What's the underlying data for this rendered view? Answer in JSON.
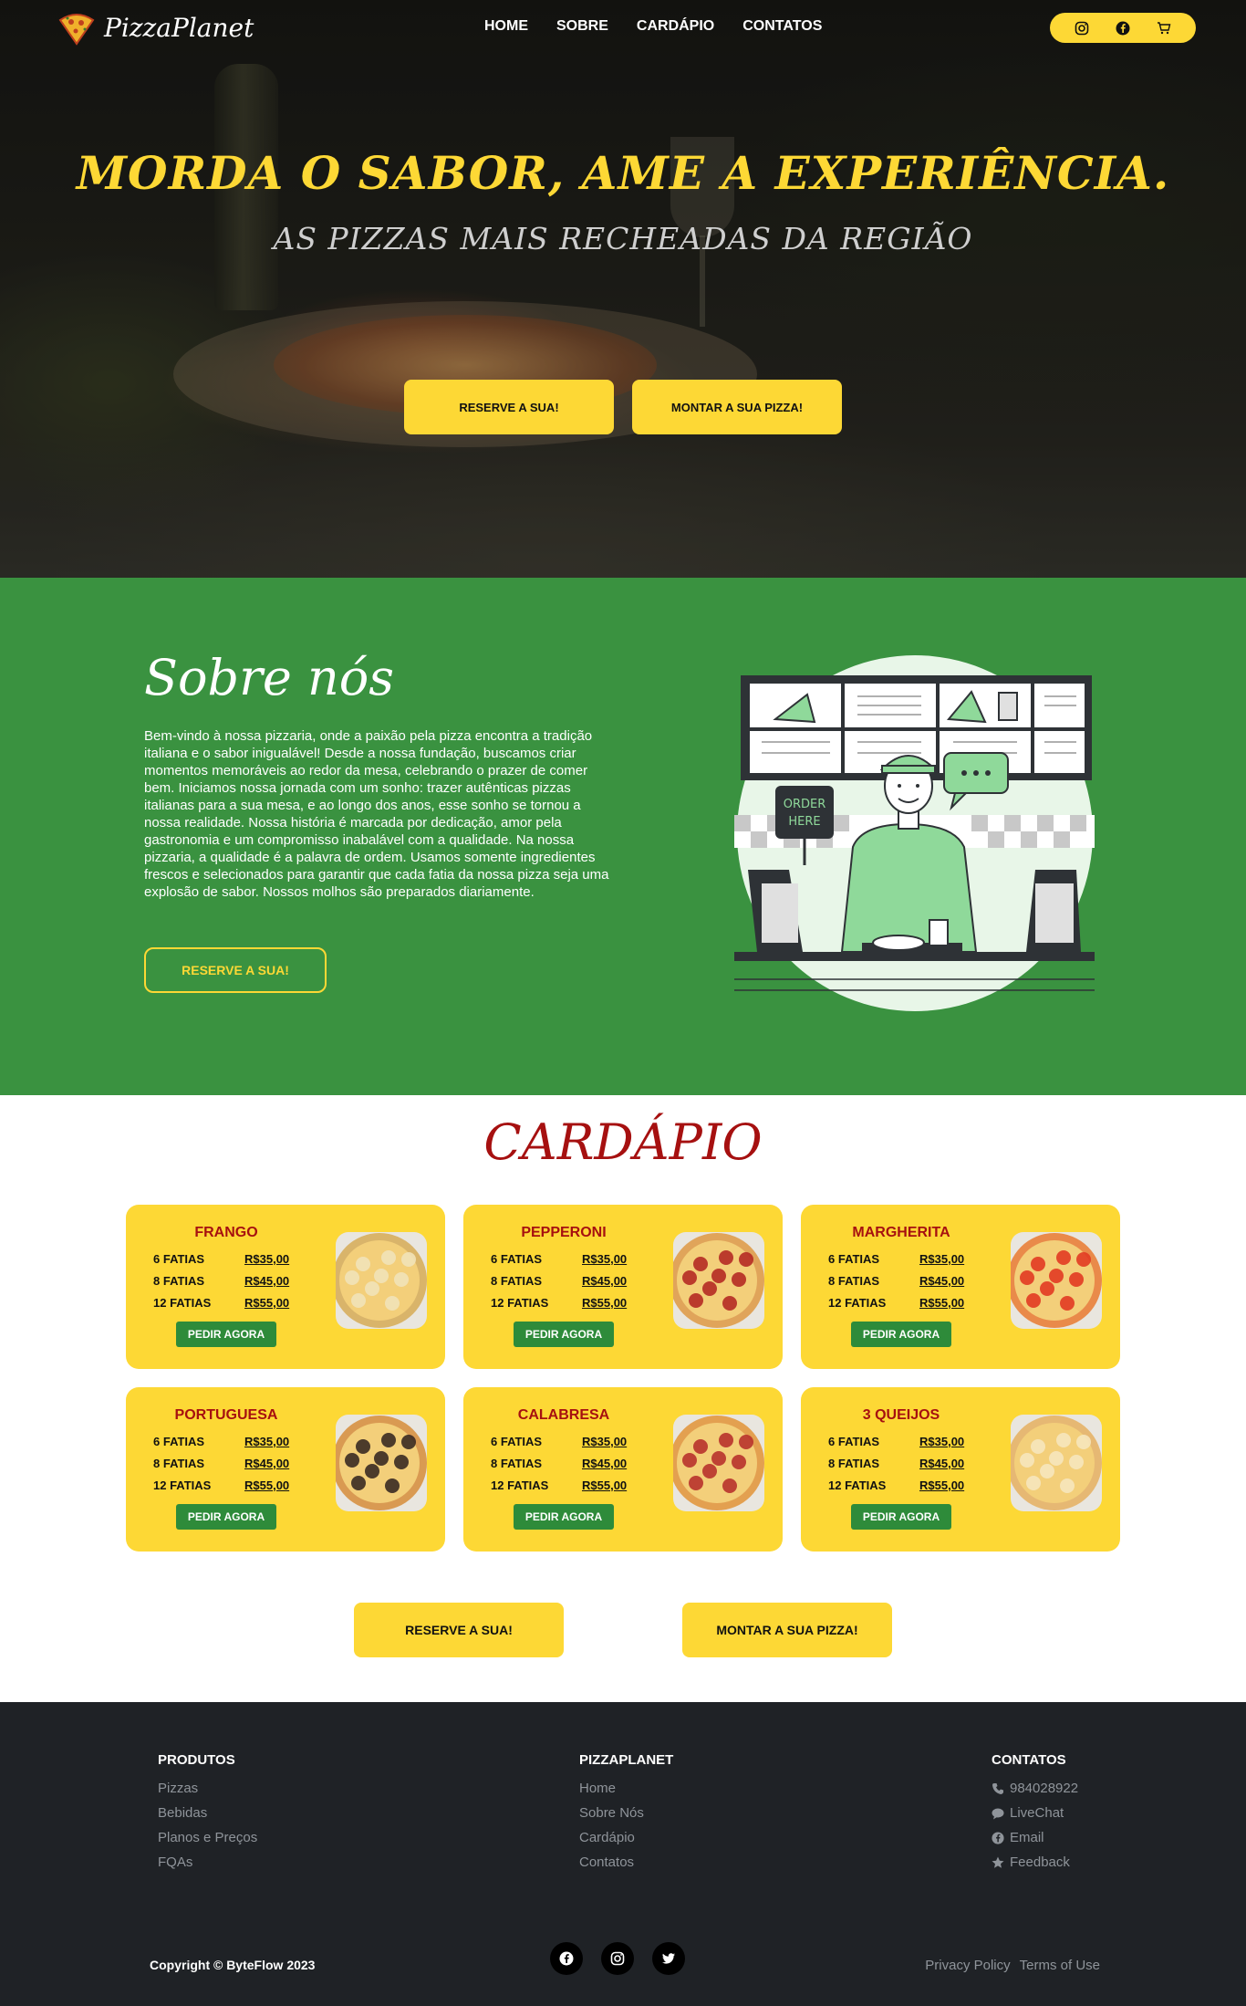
{
  "brand": {
    "name": "PizzaPlanet"
  },
  "nav": {
    "items": [
      "HOME",
      "SOBRE",
      "CARDÁPIO",
      "CONTATOS"
    ]
  },
  "header_icons": [
    "instagram-icon",
    "facebook-icon",
    "cart-icon"
  ],
  "hero": {
    "title": "MORDA O SABOR, AME A EXPERIÊNCIA.",
    "subtitle": "AS PIZZAS MAIS RECHEADAS DA REGIÃO",
    "buttons": [
      "RESERVE A SUA!",
      "MONTAR A SUA PIZZA!"
    ]
  },
  "about": {
    "title": "Sobre nós",
    "text": "Bem-vindo à nossa pizzaria, onde a paixão pela pizza encontra a tradição italiana e o sabor inigualável! Desde a nossa fundação, buscamos criar momentos memoráveis ao redor da mesa, celebrando o prazer de comer bem. Iniciamos nossa jornada com um sonho: trazer autênticas pizzas italianas para a sua mesa, e ao longo dos anos, esse sonho se tornou a nossa realidade. Nossa história é marcada por dedicação, amor pela gastronomia e um compromisso inabalável com a qualidade. Na nossa pizzaria, a qualidade é a palavra de ordem. Usamos somente ingredientes frescos e selecionados para garantir que cada fatia da nossa pizza seja uma explosão de sabor. Nossos molhos são preparados diariamente.",
    "button": "RESERVE A SUA!",
    "illustration_sign": [
      "ORDER",
      "HERE"
    ]
  },
  "menu": {
    "title": "CARDÁPIO",
    "order_label": "PEDIR AGORA",
    "items": [
      {
        "name": "FRANGO",
        "sizes": [
          {
            "qty": "6 FATIAS",
            "price": "R$35,00"
          },
          {
            "qty": "8 FATIAS",
            "price": "R$45,00"
          },
          {
            "qty": "12 FATIAS",
            "price": "R$55,00"
          }
        ],
        "photo_color": "#d9b46a",
        "topping_color": "#f1e2b8"
      },
      {
        "name": "PEPPERONI",
        "sizes": [
          {
            "qty": "6 FATIAS",
            "price": "R$35,00"
          },
          {
            "qty": "8 FATIAS",
            "price": "R$45,00"
          },
          {
            "qty": "12 FATIAS",
            "price": "R$55,00"
          }
        ],
        "photo_color": "#e0a45a",
        "topping_color": "#b52a24"
      },
      {
        "name": "MARGHERITA",
        "sizes": [
          {
            "qty": "6 FATIAS",
            "price": "R$35,00"
          },
          {
            "qty": "8 FATIAS",
            "price": "R$45,00"
          },
          {
            "qty": "12 FATIAS",
            "price": "R$55,00"
          }
        ],
        "photo_color": "#e98a4a",
        "topping_color": "#e23a22"
      },
      {
        "name": "PORTUGUESA",
        "sizes": [
          {
            "qty": "6 FATIAS",
            "price": "R$35,00"
          },
          {
            "qty": "8 FATIAS",
            "price": "R$45,00"
          },
          {
            "qty": "12 FATIAS",
            "price": "R$55,00"
          }
        ],
        "photo_color": "#d99a52",
        "topping_color": "#3a2a22"
      },
      {
        "name": "CALABRESA",
        "sizes": [
          {
            "qty": "6 FATIAS",
            "price": "R$35,00"
          },
          {
            "qty": "8 FATIAS",
            "price": "R$45,00"
          },
          {
            "qty": "12 FATIAS",
            "price": "R$55,00"
          }
        ],
        "photo_color": "#e3a050",
        "topping_color": "#b8322c"
      },
      {
        "name": "3 QUEIJOS",
        "sizes": [
          {
            "qty": "6 FATIAS",
            "price": "R$35,00"
          },
          {
            "qty": "8 FATIAS",
            "price": "R$45,00"
          },
          {
            "qty": "12 FATIAS",
            "price": "R$55,00"
          }
        ],
        "photo_color": "#e6b873",
        "topping_color": "#f6e6bd"
      }
    ],
    "buttons": [
      "RESERVE A SUA!",
      "MONTAR A SUA PIZZA!"
    ]
  },
  "footer": {
    "columns": [
      {
        "title": "PRODUTOS",
        "links": [
          "Pizzas",
          "Bebidas",
          "Planos e Preços",
          "FQAs"
        ]
      },
      {
        "title": "PIZZAPLANET",
        "links": [
          "Home",
          "Sobre Nós",
          "Cardápio",
          "Contatos"
        ]
      },
      {
        "title": "CONTATOS",
        "links": [
          "984028922",
          "LiveChat",
          "Email",
          "Feedback"
        ],
        "icons": [
          "phone-icon",
          "chat-icon",
          "facebook-icon",
          "star-icon"
        ]
      }
    ],
    "copyright": "Copyright © ByteFlow 2023",
    "social_icons": [
      "facebook-icon",
      "instagram-icon",
      "twitter-icon"
    ],
    "legal_links": [
      "Privacy Policy",
      "Terms of Use"
    ]
  },
  "colors": {
    "accent_yellow": "#fdd835",
    "about_green": "#3a9240",
    "menu_red": "#a61010",
    "order_green": "#2e8b3a",
    "footer_bg": "#1f2226"
  }
}
